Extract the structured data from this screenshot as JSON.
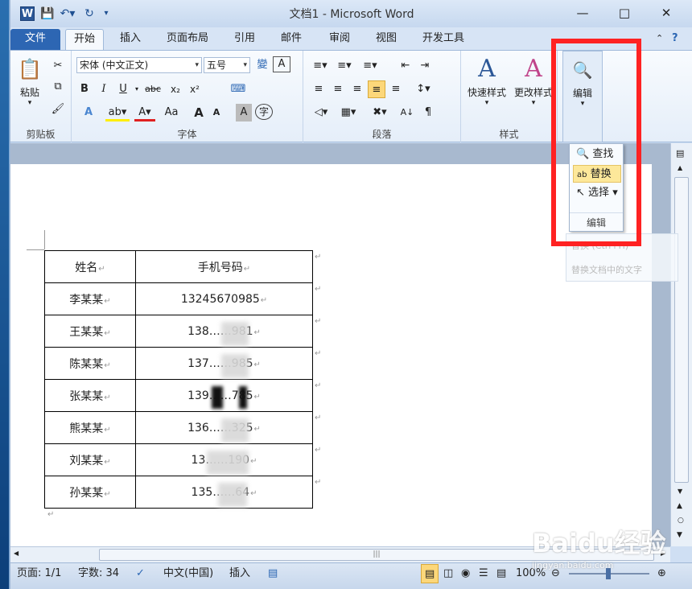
{
  "window": {
    "title": "文档1 - Microsoft Word",
    "app_icon": "W",
    "quick_access": [
      "save-icon",
      "undo-icon",
      "redo-icon",
      "customize-icon"
    ],
    "controls": [
      "minimize-icon",
      "maximize-icon",
      "close-icon"
    ]
  },
  "tabs": [
    "文件",
    "开始",
    "插入",
    "页面布局",
    "引用",
    "邮件",
    "审阅",
    "视图",
    "开发工具"
  ],
  "active_tab": "开始",
  "ribbon": {
    "clipboard": {
      "paste_label": "粘贴",
      "group_label": "剪贴板"
    },
    "font": {
      "font_name": "宋体 (中文正文)",
      "font_size": "五号",
      "group_label": "字体",
      "buttons": [
        "B",
        "I",
        "U",
        "abc",
        "x₂",
        "x²",
        "A",
        "Aa",
        "A",
        "A",
        "A",
        "字"
      ]
    },
    "paragraph": {
      "group_label": "段落"
    },
    "styles": {
      "quick_styles": "快速样式",
      "change_styles": "更改样式",
      "group_label": "样式"
    },
    "editing": {
      "button_label": "编辑"
    }
  },
  "edit_dropdown": {
    "items": [
      "查找",
      "替换",
      "选择"
    ],
    "highlighted": "替换",
    "group_label": "编辑"
  },
  "tooltip_text": [
    "替换 (Ctrl+H)",
    "替换文档中的文字"
  ],
  "table": {
    "headers": [
      "姓名",
      "手机号码"
    ],
    "rows": [
      [
        "李某某",
        "13245670985"
      ],
      [
        "王某某",
        "138……981"
      ],
      [
        "陈某某",
        "137……985"
      ],
      [
        "张某某",
        "139……785"
      ],
      [
        "熊某某",
        "136……325"
      ],
      [
        "刘某某",
        "13……190"
      ],
      [
        "孙某某",
        "135……64"
      ]
    ]
  },
  "status": {
    "page": "页面: 1/1",
    "words": "字数: 34",
    "language": "中文(中国)",
    "mode": "插入",
    "zoom": "100%"
  },
  "watermark": {
    "text": "Baidu经验",
    "sub": "jingyan.baidu.com"
  },
  "colors": {
    "highlight_box": "#ff2222",
    "file_tab": "#2d66b3"
  }
}
